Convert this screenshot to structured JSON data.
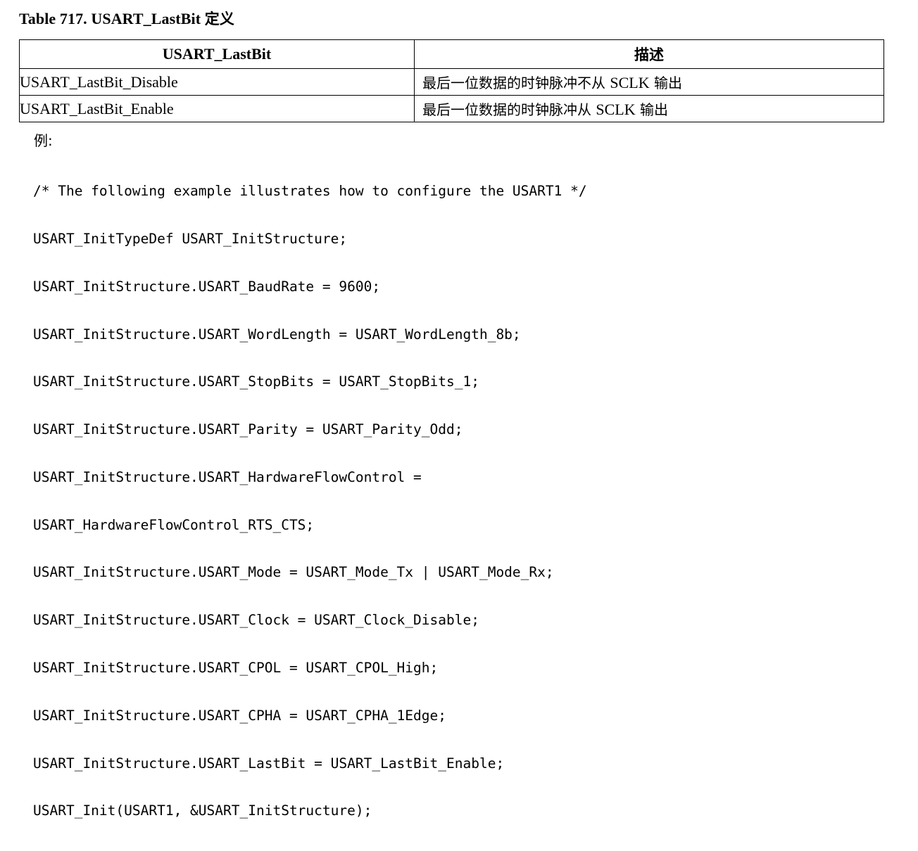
{
  "document": {
    "table_caption": {
      "prefix": "Table 717. USART_LastBit ",
      "cjk": "定义",
      "full": "Table 717. USART_LastBit 定义"
    },
    "table": {
      "headers": [
        "USART_LastBit",
        "描述"
      ],
      "rows": [
        {
          "name": "USART_LastBit_Disable",
          "desc_pre": "最后一位数据的时钟脉冲不从 ",
          "desc_latin": "SCLK",
          "desc_post": " 输出",
          "desc_full": "最后一位数据的时钟脉冲不从 SCLK 输出"
        },
        {
          "name": "USART_LastBit_Enable",
          "desc_pre": "最后一位数据的时钟脉冲从 ",
          "desc_latin": "SCLK",
          "desc_post": " 输出",
          "desc_full": "最后一位数据的时钟脉冲从 SCLK 输出"
        }
      ]
    },
    "example": {
      "label": "例:",
      "code_lines": [
        "/* The following example illustrates how to configure the USART1 */",
        "USART_InitTypeDef USART_InitStructure;",
        "USART_InitStructure.USART_BaudRate = 9600;",
        "USART_InitStructure.USART_WordLength = USART_WordLength_8b;",
        "USART_InitStructure.USART_StopBits = USART_StopBits_1;",
        "USART_InitStructure.USART_Parity = USART_Parity_Odd;",
        "USART_InitStructure.USART_HardwareFlowControl =",
        "USART_HardwareFlowControl_RTS_CTS;",
        "USART_InitStructure.USART_Mode = USART_Mode_Tx | USART_Mode_Rx;",
        "USART_InitStructure.USART_Clock = USART_Clock_Disable;",
        "USART_InitStructure.USART_CPOL = USART_CPOL_High;",
        "USART_InitStructure.USART_CPHA = USART_CPHA_1Edge;",
        "USART_InitStructure.USART_LastBit = USART_LastBit_Enable;",
        "USART_Init(USART1, &USART_InitStructure);"
      ]
    },
    "colors": {
      "text": "#000000",
      "background": "#ffffff",
      "border": "#000000"
    }
  }
}
